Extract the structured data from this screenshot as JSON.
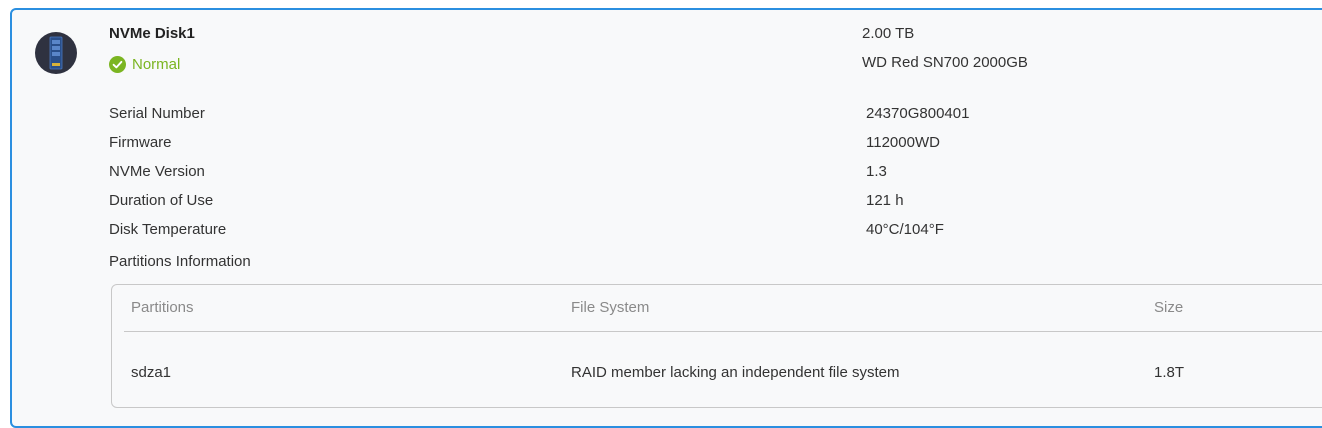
{
  "disk": {
    "name": "NVMe Disk1",
    "status": "Normal",
    "capacity": "2.00 TB",
    "model": "WD Red SN700 2000GB",
    "icon": "nvme-disk-icon",
    "status_icon": "check-circle-icon"
  },
  "details": [
    {
      "label": "Serial Number",
      "value": "24370G800401"
    },
    {
      "label": "Firmware",
      "value": "112000WD"
    },
    {
      "label": "NVMe Version",
      "value": "1.3"
    },
    {
      "label": "Duration of Use",
      "value": "121 h"
    },
    {
      "label": "Disk Temperature",
      "value": "40°C/104°F"
    }
  ],
  "partitions": {
    "title": "Partitions Information",
    "columns": [
      "Partitions",
      "File System",
      "Size"
    ],
    "rows": [
      {
        "partition": "sdza1",
        "file_system": "RAID member lacking an independent file system",
        "size": "1.8T"
      }
    ]
  },
  "colors": {
    "accent_border": "#2b8fe0",
    "status_normal": "#7bb521",
    "icon_background": "#2f3240"
  }
}
